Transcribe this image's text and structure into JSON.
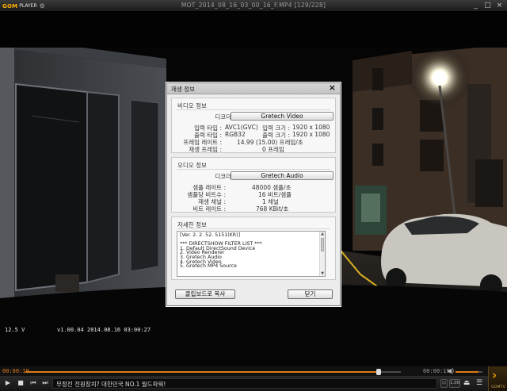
{
  "app": {
    "logo_primary": "GOM",
    "logo_secondary": "PLAYER",
    "window_title": "MOT_2014_08_16_03_00_16_F.MP4 [129/228]",
    "controls": {
      "minimize": "_",
      "maximize": "□",
      "close": "×"
    }
  },
  "video": {
    "osd_voltage": "12.5 V",
    "osd_version": "v1.00.04",
    "osd_datetime": "2014.08.16 03:00:27"
  },
  "dialog": {
    "title": "재생 정보",
    "close_label": "×",
    "video_section": {
      "title": "비디오 정보",
      "codec_label": "디코더 :",
      "codec_button": "Gretech Video",
      "rows_left": [
        {
          "label": "입력 타입 :",
          "value": "AVC1(GVC)"
        },
        {
          "label": "출력 타입 :",
          "value": "RGB32"
        },
        {
          "label": "프레임 레이트 :",
          "value": "14.99 (15.00) 프레임/초"
        },
        {
          "label": "재생 프레임 :",
          "value": "0 프레임"
        }
      ],
      "rows_right": [
        {
          "label": "입력 크기 :",
          "value": "1920 x 1080"
        },
        {
          "label": "출력 크기 :",
          "value": "1920 x 1080"
        }
      ]
    },
    "audio_section": {
      "title": "오디오 정보",
      "codec_label": "디코더 :",
      "codec_button": "Gretech Audio",
      "rows": [
        {
          "label": "샘플 레이트 :",
          "value": "48000 샘플/초"
        },
        {
          "label": "샘플당 비트수 :",
          "value": "16 비트/샘플"
        },
        {
          "label": "재생 채널 :",
          "value": "1 채널"
        },
        {
          "label": "비트 레이트 :",
          "value": "768 KBit/초"
        }
      ]
    },
    "detail_section": {
      "title": "자세한 정보",
      "lines": [
        "[Ver. 2. 2. 52. 5151(KR)]",
        "",
        "*** DIRECTSHOW FILTER LIST ***",
        "1. Default DirectSound Device",
        "2. Video Renderer",
        "3. Gretech Audio",
        "4. Gretech Video",
        "5. Gretech MP4 Source"
      ]
    },
    "copy_button": "클립보드로 복사",
    "close_button": "닫기"
  },
  "playback": {
    "current_time": "00:00:19",
    "remaining_time": "00:00:19",
    "progress": 0.94,
    "volume": 0.85,
    "ticker": "무정전 전원장치? 대한민국 NO.1 월드파워!",
    "speed_label": "1.00",
    "gomtv_label": "GOMTV",
    "accent_color": "#e07a18"
  }
}
